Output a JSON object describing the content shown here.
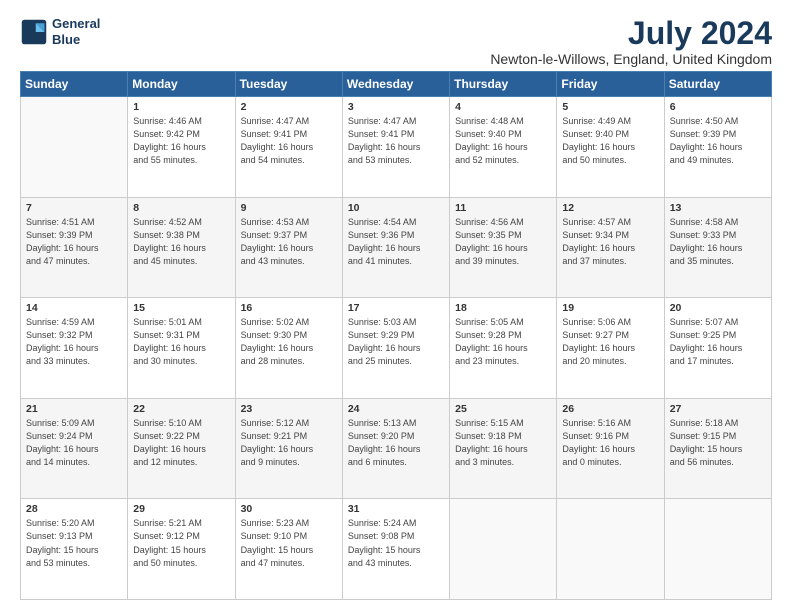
{
  "header": {
    "logo_line1": "General",
    "logo_line2": "Blue",
    "title": "July 2024",
    "subtitle": "Newton-le-Willows, England, United Kingdom"
  },
  "weekdays": [
    "Sunday",
    "Monday",
    "Tuesday",
    "Wednesday",
    "Thursday",
    "Friday",
    "Saturday"
  ],
  "weeks": [
    [
      {
        "day": "",
        "info": ""
      },
      {
        "day": "1",
        "info": "Sunrise: 4:46 AM\nSunset: 9:42 PM\nDaylight: 16 hours\nand 55 minutes."
      },
      {
        "day": "2",
        "info": "Sunrise: 4:47 AM\nSunset: 9:41 PM\nDaylight: 16 hours\nand 54 minutes."
      },
      {
        "day": "3",
        "info": "Sunrise: 4:47 AM\nSunset: 9:41 PM\nDaylight: 16 hours\nand 53 minutes."
      },
      {
        "day": "4",
        "info": "Sunrise: 4:48 AM\nSunset: 9:40 PM\nDaylight: 16 hours\nand 52 minutes."
      },
      {
        "day": "5",
        "info": "Sunrise: 4:49 AM\nSunset: 9:40 PM\nDaylight: 16 hours\nand 50 minutes."
      },
      {
        "day": "6",
        "info": "Sunrise: 4:50 AM\nSunset: 9:39 PM\nDaylight: 16 hours\nand 49 minutes."
      }
    ],
    [
      {
        "day": "7",
        "info": "Sunrise: 4:51 AM\nSunset: 9:39 PM\nDaylight: 16 hours\nand 47 minutes."
      },
      {
        "day": "8",
        "info": "Sunrise: 4:52 AM\nSunset: 9:38 PM\nDaylight: 16 hours\nand 45 minutes."
      },
      {
        "day": "9",
        "info": "Sunrise: 4:53 AM\nSunset: 9:37 PM\nDaylight: 16 hours\nand 43 minutes."
      },
      {
        "day": "10",
        "info": "Sunrise: 4:54 AM\nSunset: 9:36 PM\nDaylight: 16 hours\nand 41 minutes."
      },
      {
        "day": "11",
        "info": "Sunrise: 4:56 AM\nSunset: 9:35 PM\nDaylight: 16 hours\nand 39 minutes."
      },
      {
        "day": "12",
        "info": "Sunrise: 4:57 AM\nSunset: 9:34 PM\nDaylight: 16 hours\nand 37 minutes."
      },
      {
        "day": "13",
        "info": "Sunrise: 4:58 AM\nSunset: 9:33 PM\nDaylight: 16 hours\nand 35 minutes."
      }
    ],
    [
      {
        "day": "14",
        "info": "Sunrise: 4:59 AM\nSunset: 9:32 PM\nDaylight: 16 hours\nand 33 minutes."
      },
      {
        "day": "15",
        "info": "Sunrise: 5:01 AM\nSunset: 9:31 PM\nDaylight: 16 hours\nand 30 minutes."
      },
      {
        "day": "16",
        "info": "Sunrise: 5:02 AM\nSunset: 9:30 PM\nDaylight: 16 hours\nand 28 minutes."
      },
      {
        "day": "17",
        "info": "Sunrise: 5:03 AM\nSunset: 9:29 PM\nDaylight: 16 hours\nand 25 minutes."
      },
      {
        "day": "18",
        "info": "Sunrise: 5:05 AM\nSunset: 9:28 PM\nDaylight: 16 hours\nand 23 minutes."
      },
      {
        "day": "19",
        "info": "Sunrise: 5:06 AM\nSunset: 9:27 PM\nDaylight: 16 hours\nand 20 minutes."
      },
      {
        "day": "20",
        "info": "Sunrise: 5:07 AM\nSunset: 9:25 PM\nDaylight: 16 hours\nand 17 minutes."
      }
    ],
    [
      {
        "day": "21",
        "info": "Sunrise: 5:09 AM\nSunset: 9:24 PM\nDaylight: 16 hours\nand 14 minutes."
      },
      {
        "day": "22",
        "info": "Sunrise: 5:10 AM\nSunset: 9:22 PM\nDaylight: 16 hours\nand 12 minutes."
      },
      {
        "day": "23",
        "info": "Sunrise: 5:12 AM\nSunset: 9:21 PM\nDaylight: 16 hours\nand 9 minutes."
      },
      {
        "day": "24",
        "info": "Sunrise: 5:13 AM\nSunset: 9:20 PM\nDaylight: 16 hours\nand 6 minutes."
      },
      {
        "day": "25",
        "info": "Sunrise: 5:15 AM\nSunset: 9:18 PM\nDaylight: 16 hours\nand 3 minutes."
      },
      {
        "day": "26",
        "info": "Sunrise: 5:16 AM\nSunset: 9:16 PM\nDaylight: 16 hours\nand 0 minutes."
      },
      {
        "day": "27",
        "info": "Sunrise: 5:18 AM\nSunset: 9:15 PM\nDaylight: 15 hours\nand 56 minutes."
      }
    ],
    [
      {
        "day": "28",
        "info": "Sunrise: 5:20 AM\nSunset: 9:13 PM\nDaylight: 15 hours\nand 53 minutes."
      },
      {
        "day": "29",
        "info": "Sunrise: 5:21 AM\nSunset: 9:12 PM\nDaylight: 15 hours\nand 50 minutes."
      },
      {
        "day": "30",
        "info": "Sunrise: 5:23 AM\nSunset: 9:10 PM\nDaylight: 15 hours\nand 47 minutes."
      },
      {
        "day": "31",
        "info": "Sunrise: 5:24 AM\nSunset: 9:08 PM\nDaylight: 15 hours\nand 43 minutes."
      },
      {
        "day": "",
        "info": ""
      },
      {
        "day": "",
        "info": ""
      },
      {
        "day": "",
        "info": ""
      }
    ]
  ]
}
